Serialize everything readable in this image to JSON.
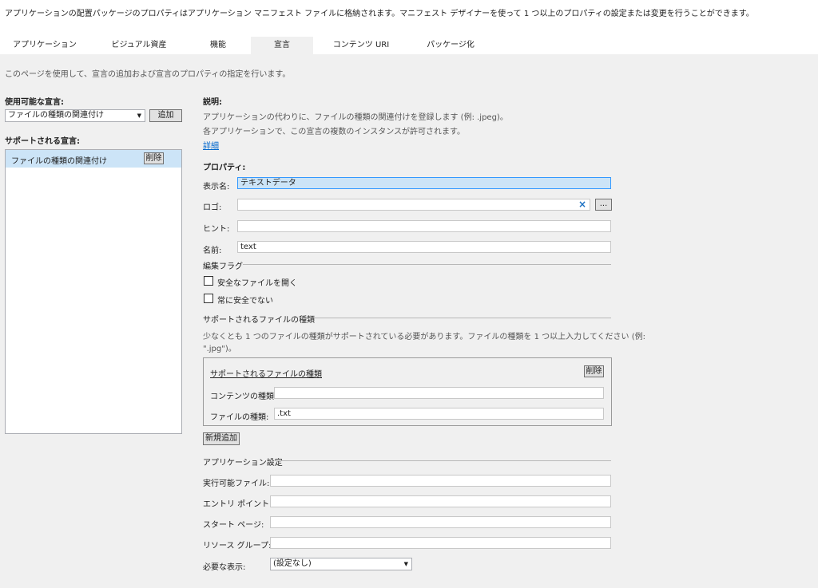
{
  "header": {
    "description": "アプリケーションの配置パッケージのプロパティはアプリケーション マニフェスト ファイルに格納されます。マニフェスト デザイナーを使って 1 つ以上のプロパティの設定または変更を行うことができます。"
  },
  "tabs": [
    {
      "label": "アプリケーション"
    },
    {
      "label": "ビジュアル資産"
    },
    {
      "label": "機能"
    },
    {
      "label": "宣言"
    },
    {
      "label": "コンテンツ URI"
    },
    {
      "label": "パッケージ化"
    }
  ],
  "active_tab": "宣言",
  "page": {
    "description": "このページを使用して、宣言の追加および宣言のプロパティの指定を行います。"
  },
  "left": {
    "available_label": "使用可能な宣言:",
    "available_value": "ファイルの種類の関連付け",
    "add_button": "追加",
    "supported_label": "サポートされる宣言:",
    "supported_items": [
      {
        "label": "ファイルの種類の関連付け",
        "remove": "削除"
      }
    ]
  },
  "right": {
    "description_label": "説明:",
    "description_line1": "アプリケーションの代わりに、ファイルの種類の関連付けを登録します (例: .jpeg)。",
    "description_line2": "各アプリケーションで、この宣言の複数のインスタンスが許可されます。",
    "more_link": "詳細",
    "properties_label": "プロパティ:",
    "display_name_label": "表示名:",
    "display_name_value": "テキストデータ",
    "logo_label": "ロゴ:",
    "logo_value": "",
    "logo_browse": "...",
    "hint_label": "ヒント:",
    "hint_value": "",
    "name_label": "名前:",
    "name_value": "text",
    "edit_flags_label": "編集フラグ",
    "checkbox_open_safe": "安全なファイルを開く",
    "checkbox_always_unsafe": "常に安全でない",
    "supported_file_types_header": "サポートされるファイルの種類",
    "supported_file_types_note1": "少なくとも 1 つのファイルの種類がサポートされている必要があります。ファイルの種類を 1 つ以上入力してください (例:",
    "supported_file_types_note2": "\".jpg\")。",
    "group_title": "サポートされるファイルの種類",
    "group_remove": "削除",
    "content_type_label": "コンテンツの種類:",
    "content_type_value": "",
    "file_type_label": "ファイルの種類:",
    "file_type_value": ".txt",
    "add_new_button": "新規追加",
    "app_settings_label": "アプリケーション設定",
    "executable_label": "実行可能ファイル:",
    "executable_value": "",
    "entry_point_label": "エントリ ポイント:",
    "entry_point_value": "",
    "start_page_label": "スタート ページ:",
    "start_page_value": "",
    "resource_group_label": "リソース グループ:",
    "resource_group_value": "",
    "required_view_label": "必要な表示:",
    "required_view_value": "(設定なし)"
  }
}
